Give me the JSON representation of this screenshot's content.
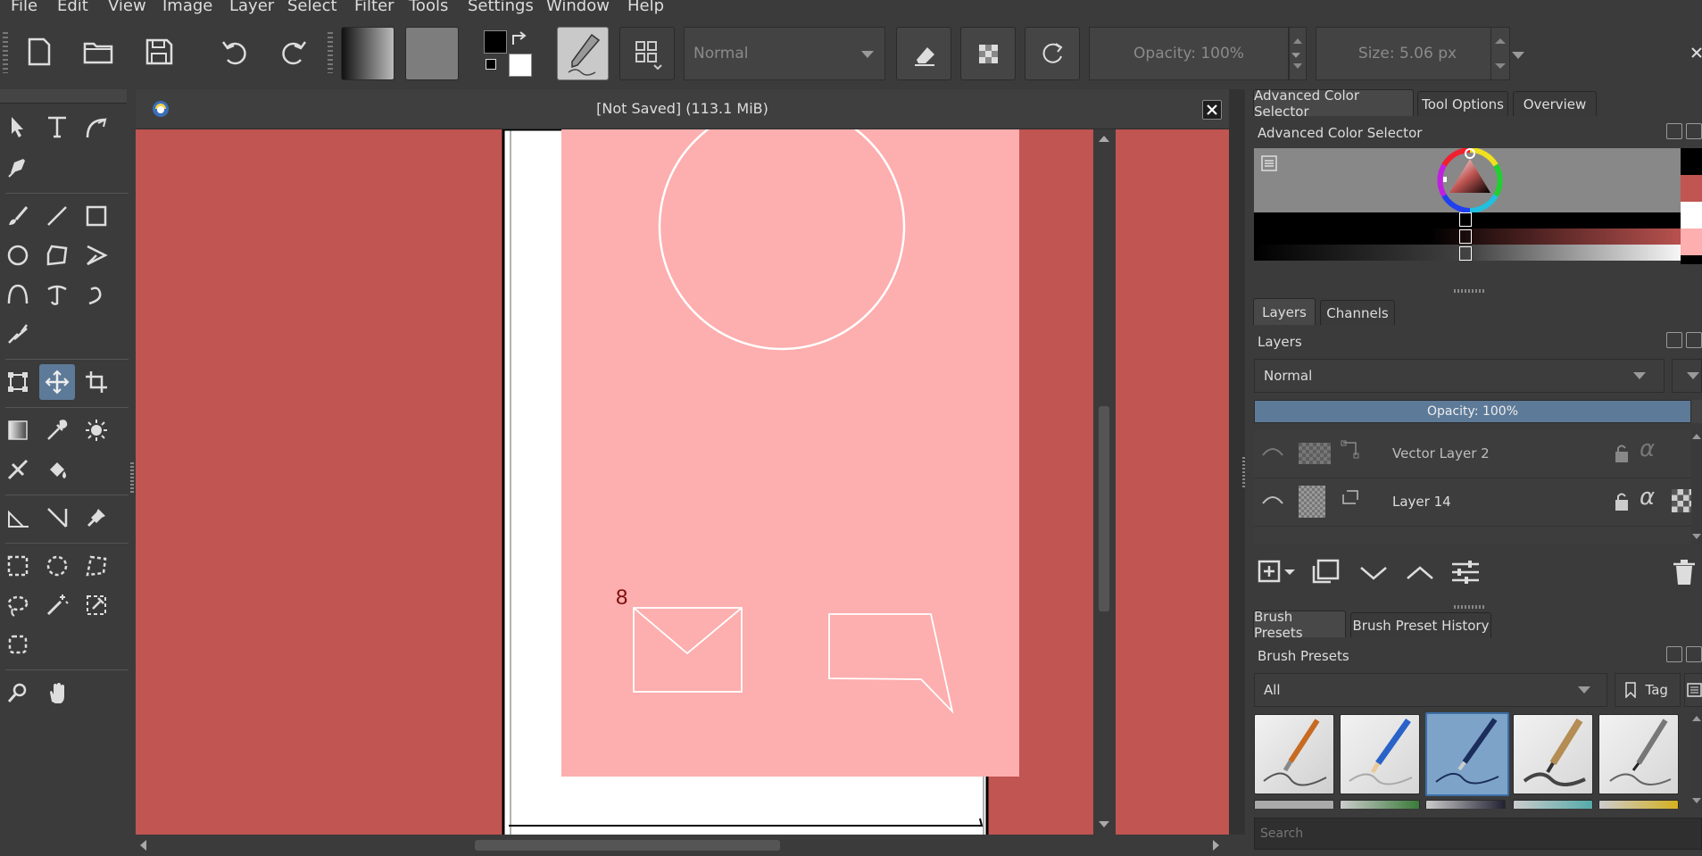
{
  "menu": [
    "File",
    "Edit",
    "View",
    "Image",
    "Layer",
    "Select",
    "Filter",
    "Tools",
    "Settings",
    "Window",
    "Help"
  ],
  "toolbar": {
    "blend_mode": "Normal",
    "opacity_label": "Opacity:",
    "opacity_value": "100%",
    "size_label": "Size:",
    "size_value": "5.06 px"
  },
  "document": {
    "title": "[Not Saved]  (113.1 MiB)",
    "canvas_annotation": "8",
    "canvas_bg": "#c05552",
    "paper_fill": "#fdaeae"
  },
  "dock": {
    "top_tabs": [
      "Advanced Color Selector",
      "Tool Options",
      "Overview"
    ],
    "color_selector_title": "Advanced Color Selector",
    "layers_tabs": [
      "Layers",
      "Channels"
    ],
    "layers_title": "Layers",
    "layers_blend": "Normal",
    "layers_opacity": "Opacity:  100%",
    "layers": [
      {
        "name": "Vector Layer 2"
      },
      {
        "name": "Layer 14"
      }
    ],
    "brush_tabs": [
      "Brush Presets",
      "Brush Preset History"
    ],
    "brush_title": "Brush Presets",
    "brush_filter": "All",
    "brush_tag": "Tag",
    "search_placeholder": "Search"
  }
}
